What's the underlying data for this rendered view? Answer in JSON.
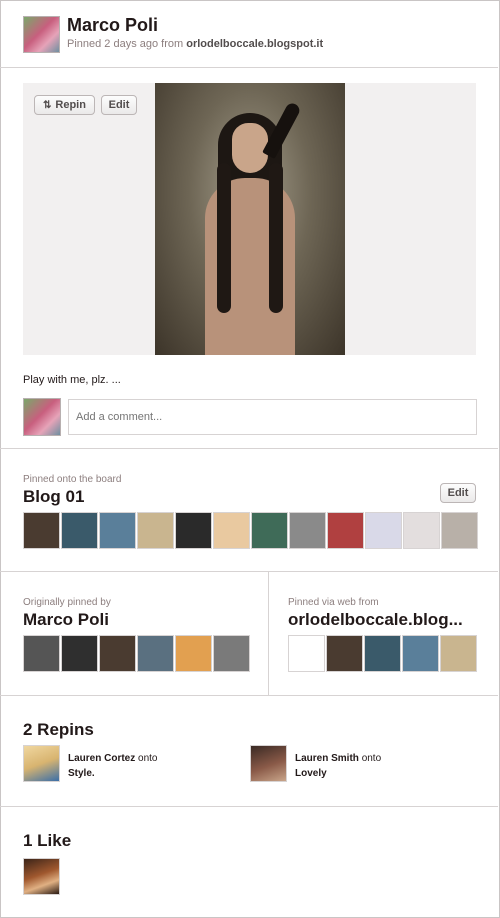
{
  "header": {
    "user_name": "Marco Poli",
    "meta_prefix": "Pinned 2 days ago from",
    "source_domain": "orlodelboccale.blogspot.it"
  },
  "pin": {
    "repin_label": "Repin",
    "edit_label": "Edit",
    "description": "Play with me, plz. ...",
    "comment_placeholder": "Add a comment..."
  },
  "board": {
    "label": "Pinned onto the board",
    "name": "Blog 01",
    "edit_label": "Edit",
    "thumb_colors": [
      "#4a3b30",
      "#3a5a6a",
      "#5a7f9a",
      "#c9b58f",
      "#2a2a2a",
      "#e9c9a0",
      "#3f6b58",
      "#8a8a8a",
      "#b04040",
      "#d9d9e8",
      "#e3dede",
      "#b8b0a8"
    ]
  },
  "originally": {
    "label": "Originally pinned by",
    "name": "Marco Poli",
    "thumb_colors": [
      "#555555",
      "#2f2f2f",
      "#4a3b30",
      "#5a7080",
      "#e2a050",
      "#7a7a7a"
    ]
  },
  "via": {
    "label": "Pinned via web from",
    "name": "orlodelboccale.blog...",
    "thumb_colors": [
      "#ffffff",
      "#4a3b30",
      "#3a5a6a",
      "#5a7f9a",
      "#c9b58f"
    ]
  },
  "repins": {
    "title": "2 Repins",
    "onto": "onto",
    "items": [
      {
        "name": "Lauren Cortez",
        "board": "Style.",
        "color": "#d8b470"
      },
      {
        "name": "Lauren Smith",
        "board": "Lovely",
        "color": "#6a4a3a"
      }
    ]
  },
  "likes": {
    "title": "1 Like"
  }
}
